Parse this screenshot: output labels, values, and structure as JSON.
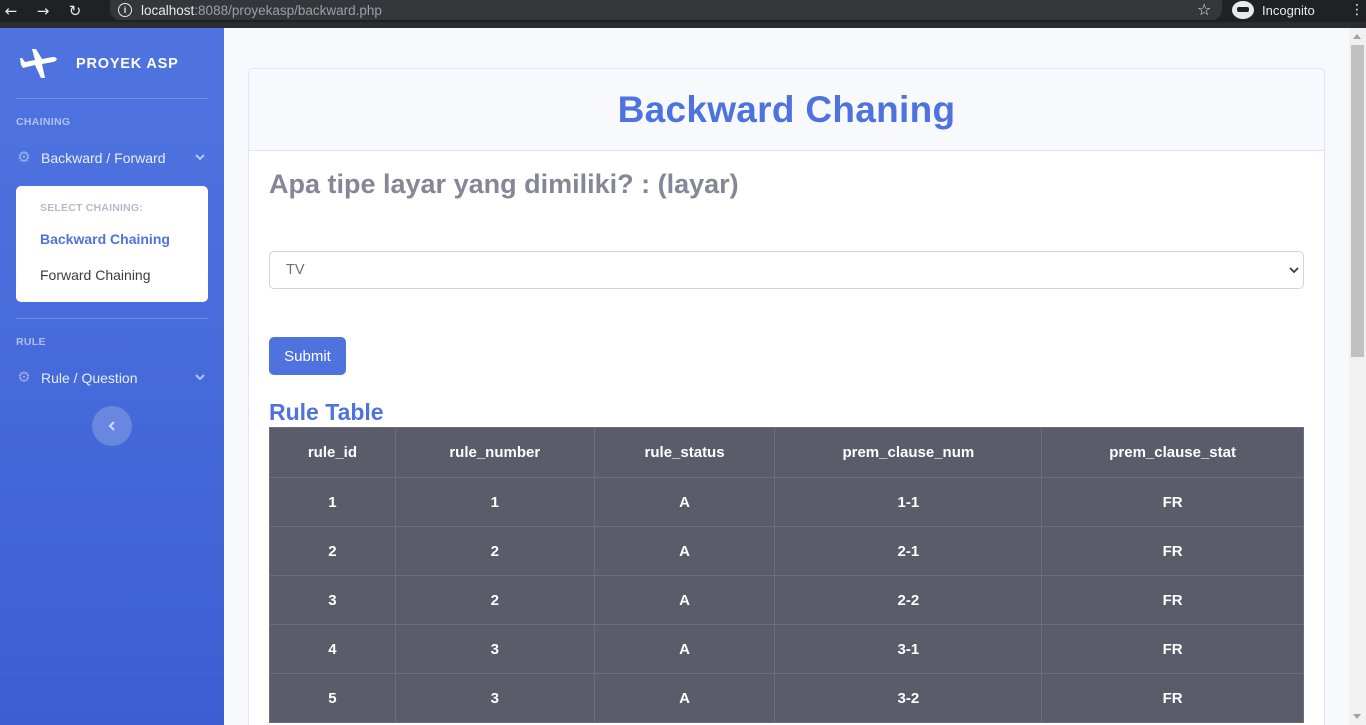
{
  "browser": {
    "url_host": "localhost",
    "url_rest": ":8088/proyekasp/backward.php",
    "profile_label": "Incognito"
  },
  "sidebar": {
    "brand": "PROYEK ASP",
    "heading_chaining": "CHAINING",
    "menu_backward_forward": "Backward / Forward",
    "collapse_heading": "SELECT CHAINING:",
    "item_backward": "Backward Chaining",
    "item_forward": "Forward Chaining",
    "heading_rule": "RULE",
    "menu_rule_question": "Rule / Question"
  },
  "main": {
    "title": "Backward Chaning",
    "question": "Apa tipe layar yang dimiliki? : (layar)",
    "select_value": "TV",
    "submit_label": "Submit",
    "table_title": "Rule Table"
  },
  "table": {
    "headers": [
      "rule_id",
      "rule_number",
      "rule_status",
      "prem_clause_num",
      "prem_clause_stat"
    ],
    "rows": [
      [
        "1",
        "1",
        "A",
        "1-1",
        "FR"
      ],
      [
        "2",
        "2",
        "A",
        "2-1",
        "FR"
      ],
      [
        "3",
        "2",
        "A",
        "2-2",
        "FR"
      ],
      [
        "4",
        "3",
        "A",
        "3-1",
        "FR"
      ],
      [
        "5",
        "3",
        "A",
        "3-2",
        "FR"
      ]
    ]
  },
  "colors": {
    "primary": "#4e73df",
    "table_bg": "#5a5c69",
    "muted_text": "#858796"
  },
  "icons": [
    "back-arrow-icon",
    "forward-arrow-icon",
    "reload-icon",
    "info-icon",
    "star-icon",
    "incognito-icon",
    "kebab-menu-icon",
    "plane-icon",
    "gear-icon",
    "chevron-down-icon",
    "chevron-left-icon"
  ]
}
